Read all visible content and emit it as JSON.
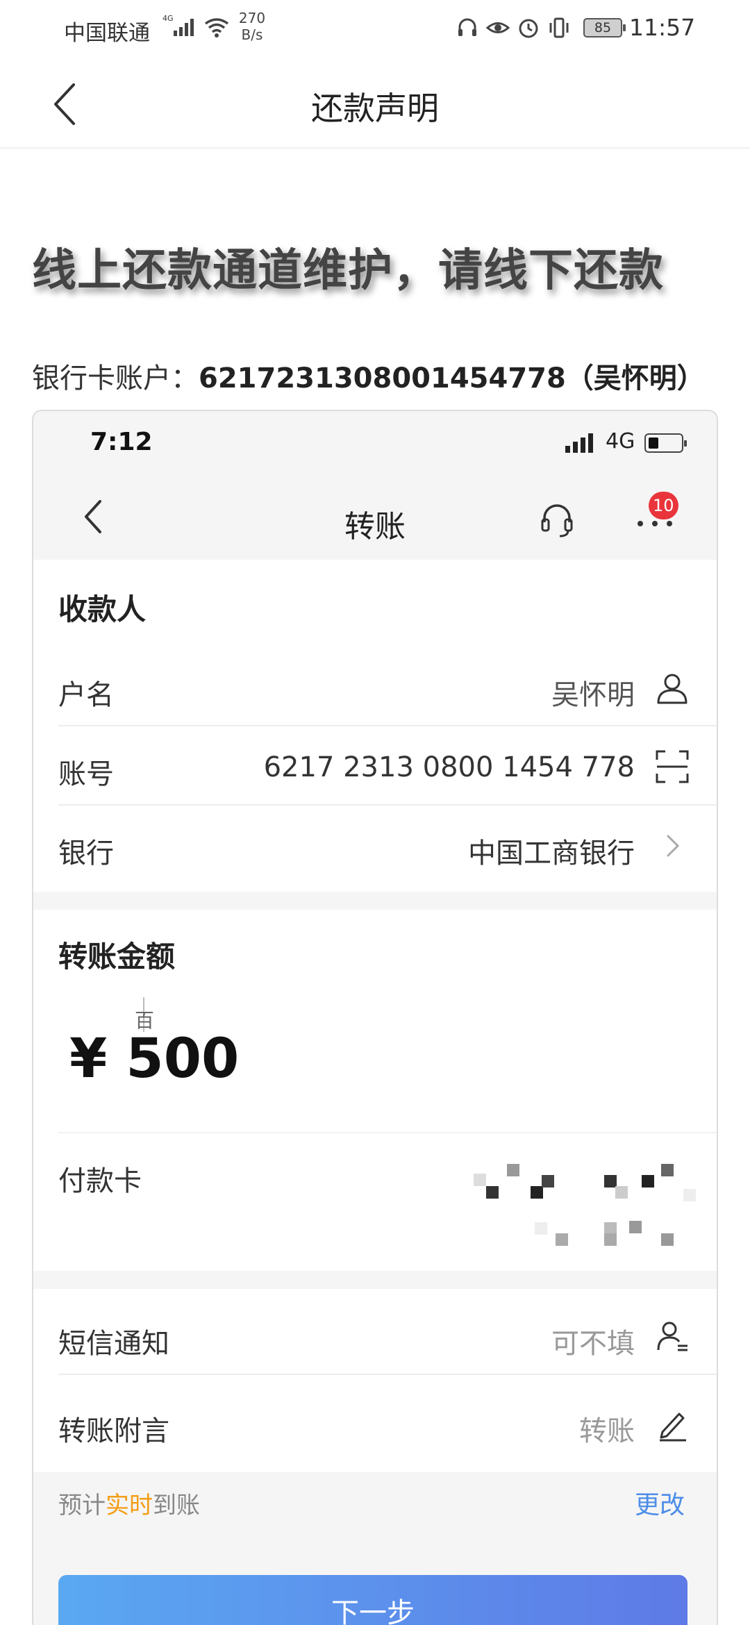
{
  "status_bar": {
    "carrier": "中国联通",
    "network_tag": "4G",
    "speed_value": "270",
    "speed_unit": "B/s",
    "battery": "85",
    "time": "11:57",
    "icons": [
      "headphone-icon",
      "eye-icon",
      "alarm-icon",
      "vibrate-icon"
    ]
  },
  "header": {
    "title": "还款声明"
  },
  "notice": {
    "text": "线上还款通道维护，请线下还款"
  },
  "account": {
    "label": "银行卡账户：",
    "value": "6217231308001454778（吴怀明）"
  },
  "screenshot": {
    "status": {
      "time": "7:12",
      "network": "4G"
    },
    "nav": {
      "title": "转账",
      "badge_count": "10"
    },
    "payee": {
      "heading": "收款人",
      "name_label": "户名",
      "name_value": "吴怀明",
      "account_label": "账号",
      "account_value": "6217 2313 0800 1454 778",
      "bank_label": "银行",
      "bank_value": "中国工商银行"
    },
    "amount": {
      "heading": "转账金额",
      "unit_hint": "百",
      "value": "¥ 500",
      "pay_card_label": "付款卡"
    },
    "extras": {
      "sms_label": "短信通知",
      "sms_placeholder": "可不填",
      "remark_label": "转账附言",
      "remark_value": "转账"
    },
    "eta": {
      "prefix": "预计",
      "highlight": "实时",
      "suffix": "到账",
      "change_label": "更改"
    },
    "next_button": "下一步"
  },
  "colors": {
    "badge": "#e9343b",
    "eta_highlight": "#f39c12",
    "link": "#4d8de8",
    "button_start": "#5aa8f2",
    "button_end": "#5e7ae6"
  }
}
